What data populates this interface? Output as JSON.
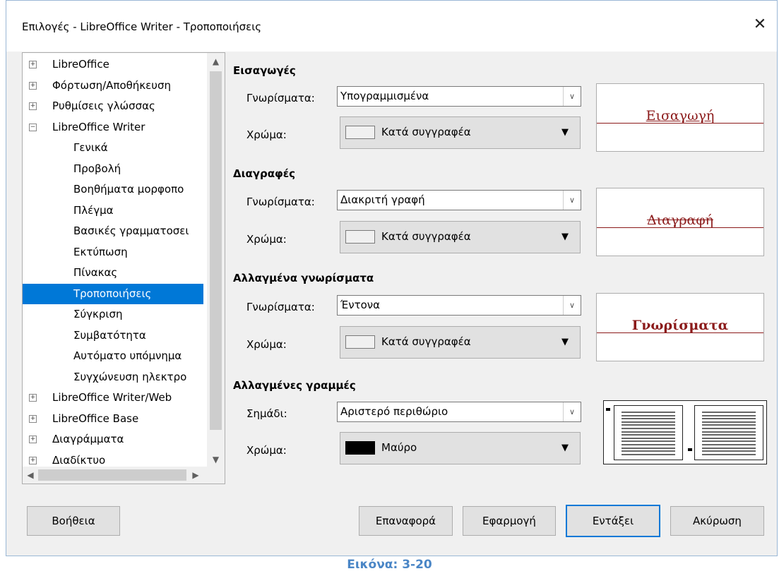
{
  "window": {
    "title": "Επιλογές - LibreOffice Writer - Τροποποιήσεις",
    "close_glyph": "✕"
  },
  "tree": {
    "items": [
      {
        "label": "LibreOffice",
        "expander": "+",
        "level": 0
      },
      {
        "label": "Φόρτωση/Αποθήκευση",
        "expander": "+",
        "level": 0
      },
      {
        "label": "Ρυθμίσεις γλώσσας",
        "expander": "+",
        "level": 0
      },
      {
        "label": "LibreOffice Writer",
        "expander": "−",
        "level": 0
      },
      {
        "label": "Γενικά",
        "level": 1
      },
      {
        "label": "Προβολή",
        "level": 1
      },
      {
        "label": "Βοηθήματα μορφοπο",
        "level": 1
      },
      {
        "label": "Πλέγμα",
        "level": 1
      },
      {
        "label": "Βασικές γραμματοσει",
        "level": 1
      },
      {
        "label": "Εκτύπωση",
        "level": 1
      },
      {
        "label": "Πίνακας",
        "level": 1
      },
      {
        "label": "Τροποποιήσεις",
        "level": 1,
        "selected": true
      },
      {
        "label": "Σύγκριση",
        "level": 1
      },
      {
        "label": "Συμβατότητα",
        "level": 1
      },
      {
        "label": "Αυτόματο υπόμνημα",
        "level": 1
      },
      {
        "label": "Συγχώνευση ηλεκτρο",
        "level": 1
      },
      {
        "label": "LibreOffice Writer/Web",
        "expander": "+",
        "level": 0
      },
      {
        "label": "LibreOffice Base",
        "expander": "+",
        "level": 0
      },
      {
        "label": "Διαγράμματα",
        "expander": "+",
        "level": 0
      },
      {
        "label": "Διαδίκτυο",
        "expander": "+",
        "level": 0
      }
    ]
  },
  "insertions": {
    "title": "Εισαγωγές",
    "attr_label": "Γνωρίσματα:",
    "attr_value": "Υπογραμμισμένα",
    "color_label": "Χρώμα:",
    "color_value": "Κατά συγγραφέα",
    "preview": "Εισαγωγή"
  },
  "deletions": {
    "title": "Διαγραφές",
    "attr_label": "Γνωρίσματα:",
    "attr_value": "Διακριτή γραφή",
    "color_label": "Χρώμα:",
    "color_value": "Κατά συγγραφέα",
    "preview": "Διαγραφή"
  },
  "changed_attributes": {
    "title": "Αλλαγμένα γνωρίσματα",
    "attr_label": "Γνωρίσματα:",
    "attr_value": "Έντονα",
    "color_label": "Χρώμα:",
    "color_value": "Κατά συγγραφέα",
    "preview": "Γνωρίσματα"
  },
  "changed_lines": {
    "title": "Αλλαγμένες γραμμές",
    "mark_label": "Σημάδι:",
    "mark_value": "Αριστερό περιθώριο",
    "color_label": "Χρώμα:",
    "color_value": "Μαύρο"
  },
  "colors": {
    "by_author_swatch": "#f0f0f0",
    "black_swatch": "#000000",
    "preview_text": "#8b1a1a",
    "selection": "#0078d7",
    "caption": "#4a86c6"
  },
  "buttons": {
    "help": "Βοήθεια",
    "reset": "Επαναφορά",
    "apply": "Εφαρμογή",
    "ok": "Εντάξει",
    "cancel": "Ακύρωση"
  },
  "caption": "Εικόνα: 3-20"
}
